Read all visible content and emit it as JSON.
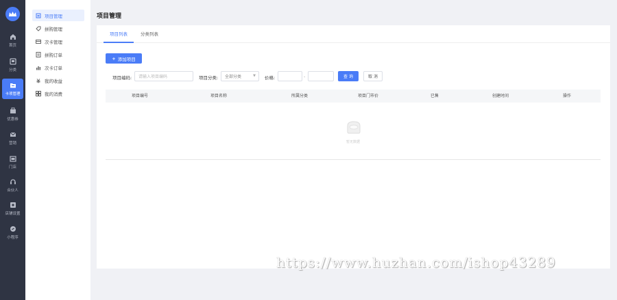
{
  "rail": {
    "items": [
      {
        "label": "首页",
        "icon": "home-icon"
      },
      {
        "label": "分类",
        "icon": "category-icon"
      },
      {
        "label": "卡项管理",
        "icon": "card-icon",
        "active": true
      },
      {
        "label": "优惠券",
        "icon": "coupon-icon"
      },
      {
        "label": "营销",
        "icon": "mail-icon"
      },
      {
        "label": "门店",
        "icon": "store-icon"
      },
      {
        "label": "合伙人",
        "icon": "headset-icon"
      },
      {
        "label": "店铺设置",
        "icon": "settings-icon"
      },
      {
        "label": "小程序",
        "icon": "miniapp-icon"
      }
    ]
  },
  "submenu": {
    "items": [
      {
        "label": "项目管理",
        "icon": "clipboard-icon",
        "active": true
      },
      {
        "label": "拼购管理",
        "icon": "tag-icon"
      },
      {
        "label": "次卡管理",
        "icon": "card-icon"
      },
      {
        "label": "拼购订单",
        "icon": "order-icon"
      },
      {
        "label": "次卡订单",
        "icon": "chart-icon"
      },
      {
        "label": "我的收益",
        "icon": "income-icon"
      },
      {
        "label": "我的消费",
        "icon": "consume-icon"
      }
    ]
  },
  "page": {
    "title": "项目管理"
  },
  "tabs": [
    {
      "label": "项目列表",
      "active": true
    },
    {
      "label": "分类列表",
      "active": false
    }
  ],
  "toolbar": {
    "add_label": "添加项目"
  },
  "filters": {
    "name_label": "项目编码:",
    "name_placeholder": "请输入项目编码",
    "category_label": "项目分类:",
    "category_value": "全部分类",
    "price_label": "价格:",
    "price_separator": "-",
    "query_label": "查 询",
    "reset_label": "取 消"
  },
  "table": {
    "columns": [
      "项目编号",
      "项目名称",
      "所属分类",
      "项目门市价",
      "已售",
      "创建时间",
      "操作"
    ],
    "empty_text": "暂无数据"
  },
  "watermark": "https://www.huzhan.com/ishop43289",
  "colors": {
    "accent": "#4a7cf7",
    "rail_bg": "#2f3443"
  }
}
